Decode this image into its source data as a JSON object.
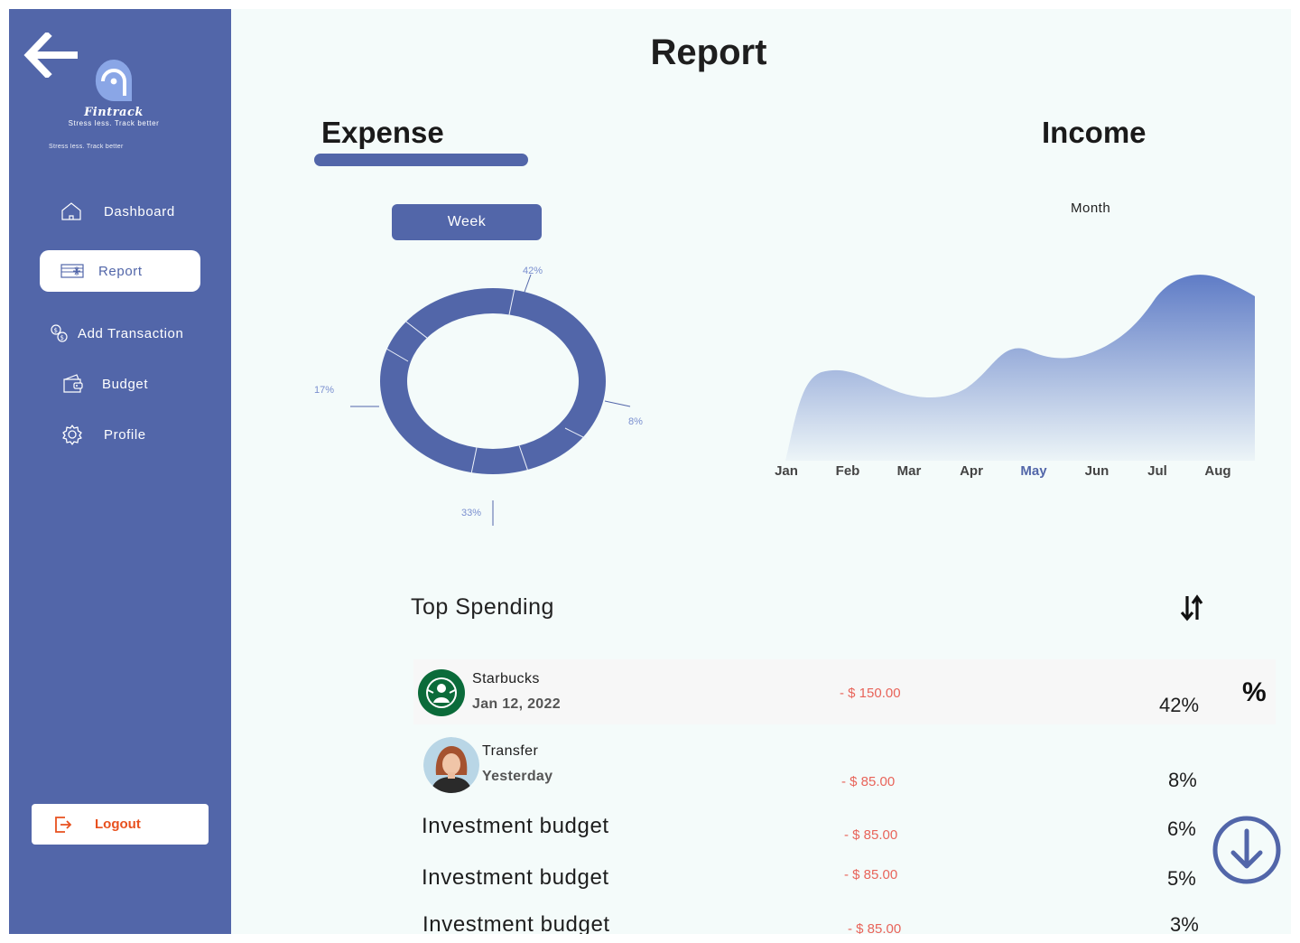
{
  "app": {
    "brand": "Fintrack",
    "tagline": "Stress less. Track better",
    "tagline_small": "Stress less. Track better"
  },
  "sidebar": {
    "items": [
      {
        "label": "Dashboard",
        "icon": "home-icon"
      },
      {
        "label": "Report",
        "icon": "report-icon",
        "active": true
      },
      {
        "label": "Add Transaction",
        "icon": "coins-icon"
      },
      {
        "label": "Budget",
        "icon": "wallet-icon"
      },
      {
        "label": "Profile",
        "icon": "gear-icon"
      }
    ],
    "logout": "Logout"
  },
  "header": {
    "title": "Report"
  },
  "tabs": {
    "expense": "Expense",
    "income": "Income",
    "active": "expense"
  },
  "expense": {
    "period_button": "Week",
    "donut": [
      {
        "label": "42%",
        "value": 42
      },
      {
        "label": "8%",
        "value": 8
      },
      {
        "label": "33%",
        "value": 33
      },
      {
        "label": "17%",
        "value": 17
      }
    ]
  },
  "income": {
    "period_label": "Month",
    "months": [
      "Jan",
      "Feb",
      "Mar",
      "Apr",
      "May",
      "Jun",
      "Jul",
      "Aug"
    ],
    "active_month": "May"
  },
  "chart_data": [
    {
      "type": "pie",
      "title": "",
      "categories": [
        "",
        "",
        "",
        ""
      ],
      "values": [
        42,
        8,
        33,
        17
      ],
      "labels": [
        "42%",
        "8%",
        "33%",
        "17%"
      ],
      "style": "donut",
      "color": "#5266a9"
    },
    {
      "type": "area",
      "title": "",
      "x": [
        "Jan",
        "Feb",
        "Mar",
        "Apr",
        "May",
        "Jun",
        "Jul",
        "Aug"
      ],
      "series": [
        {
          "values": [
            0,
            90,
            65,
            65,
            120,
            110,
            200,
            180
          ]
        }
      ],
      "color": "#6b86cc"
    }
  ],
  "top_spending": {
    "title": "Top Spending",
    "sort_icon": "sort-icon",
    "percent_icon": "%",
    "rows": [
      {
        "name": "Starbucks",
        "date": "Jan 12, 2022",
        "amount": "- $ 150.00",
        "percent": "42%"
      },
      {
        "name": "Transfer",
        "date": "Yesterday",
        "amount": "- $ 85.00",
        "percent": "8%"
      },
      {
        "name": "Investment budget",
        "amount": "- $ 85.00",
        "percent": "6%"
      },
      {
        "name": "Investment budget",
        "amount": "- $ 85.00",
        "percent": "5%"
      },
      {
        "name": "Investment budget",
        "amount": "- $ 85.00",
        "percent": "3%"
      }
    ]
  },
  "colors": {
    "primary": "#5266a9",
    "accent": "#e8511f",
    "negative": "#e8645a",
    "background": "#f4fbfa"
  }
}
